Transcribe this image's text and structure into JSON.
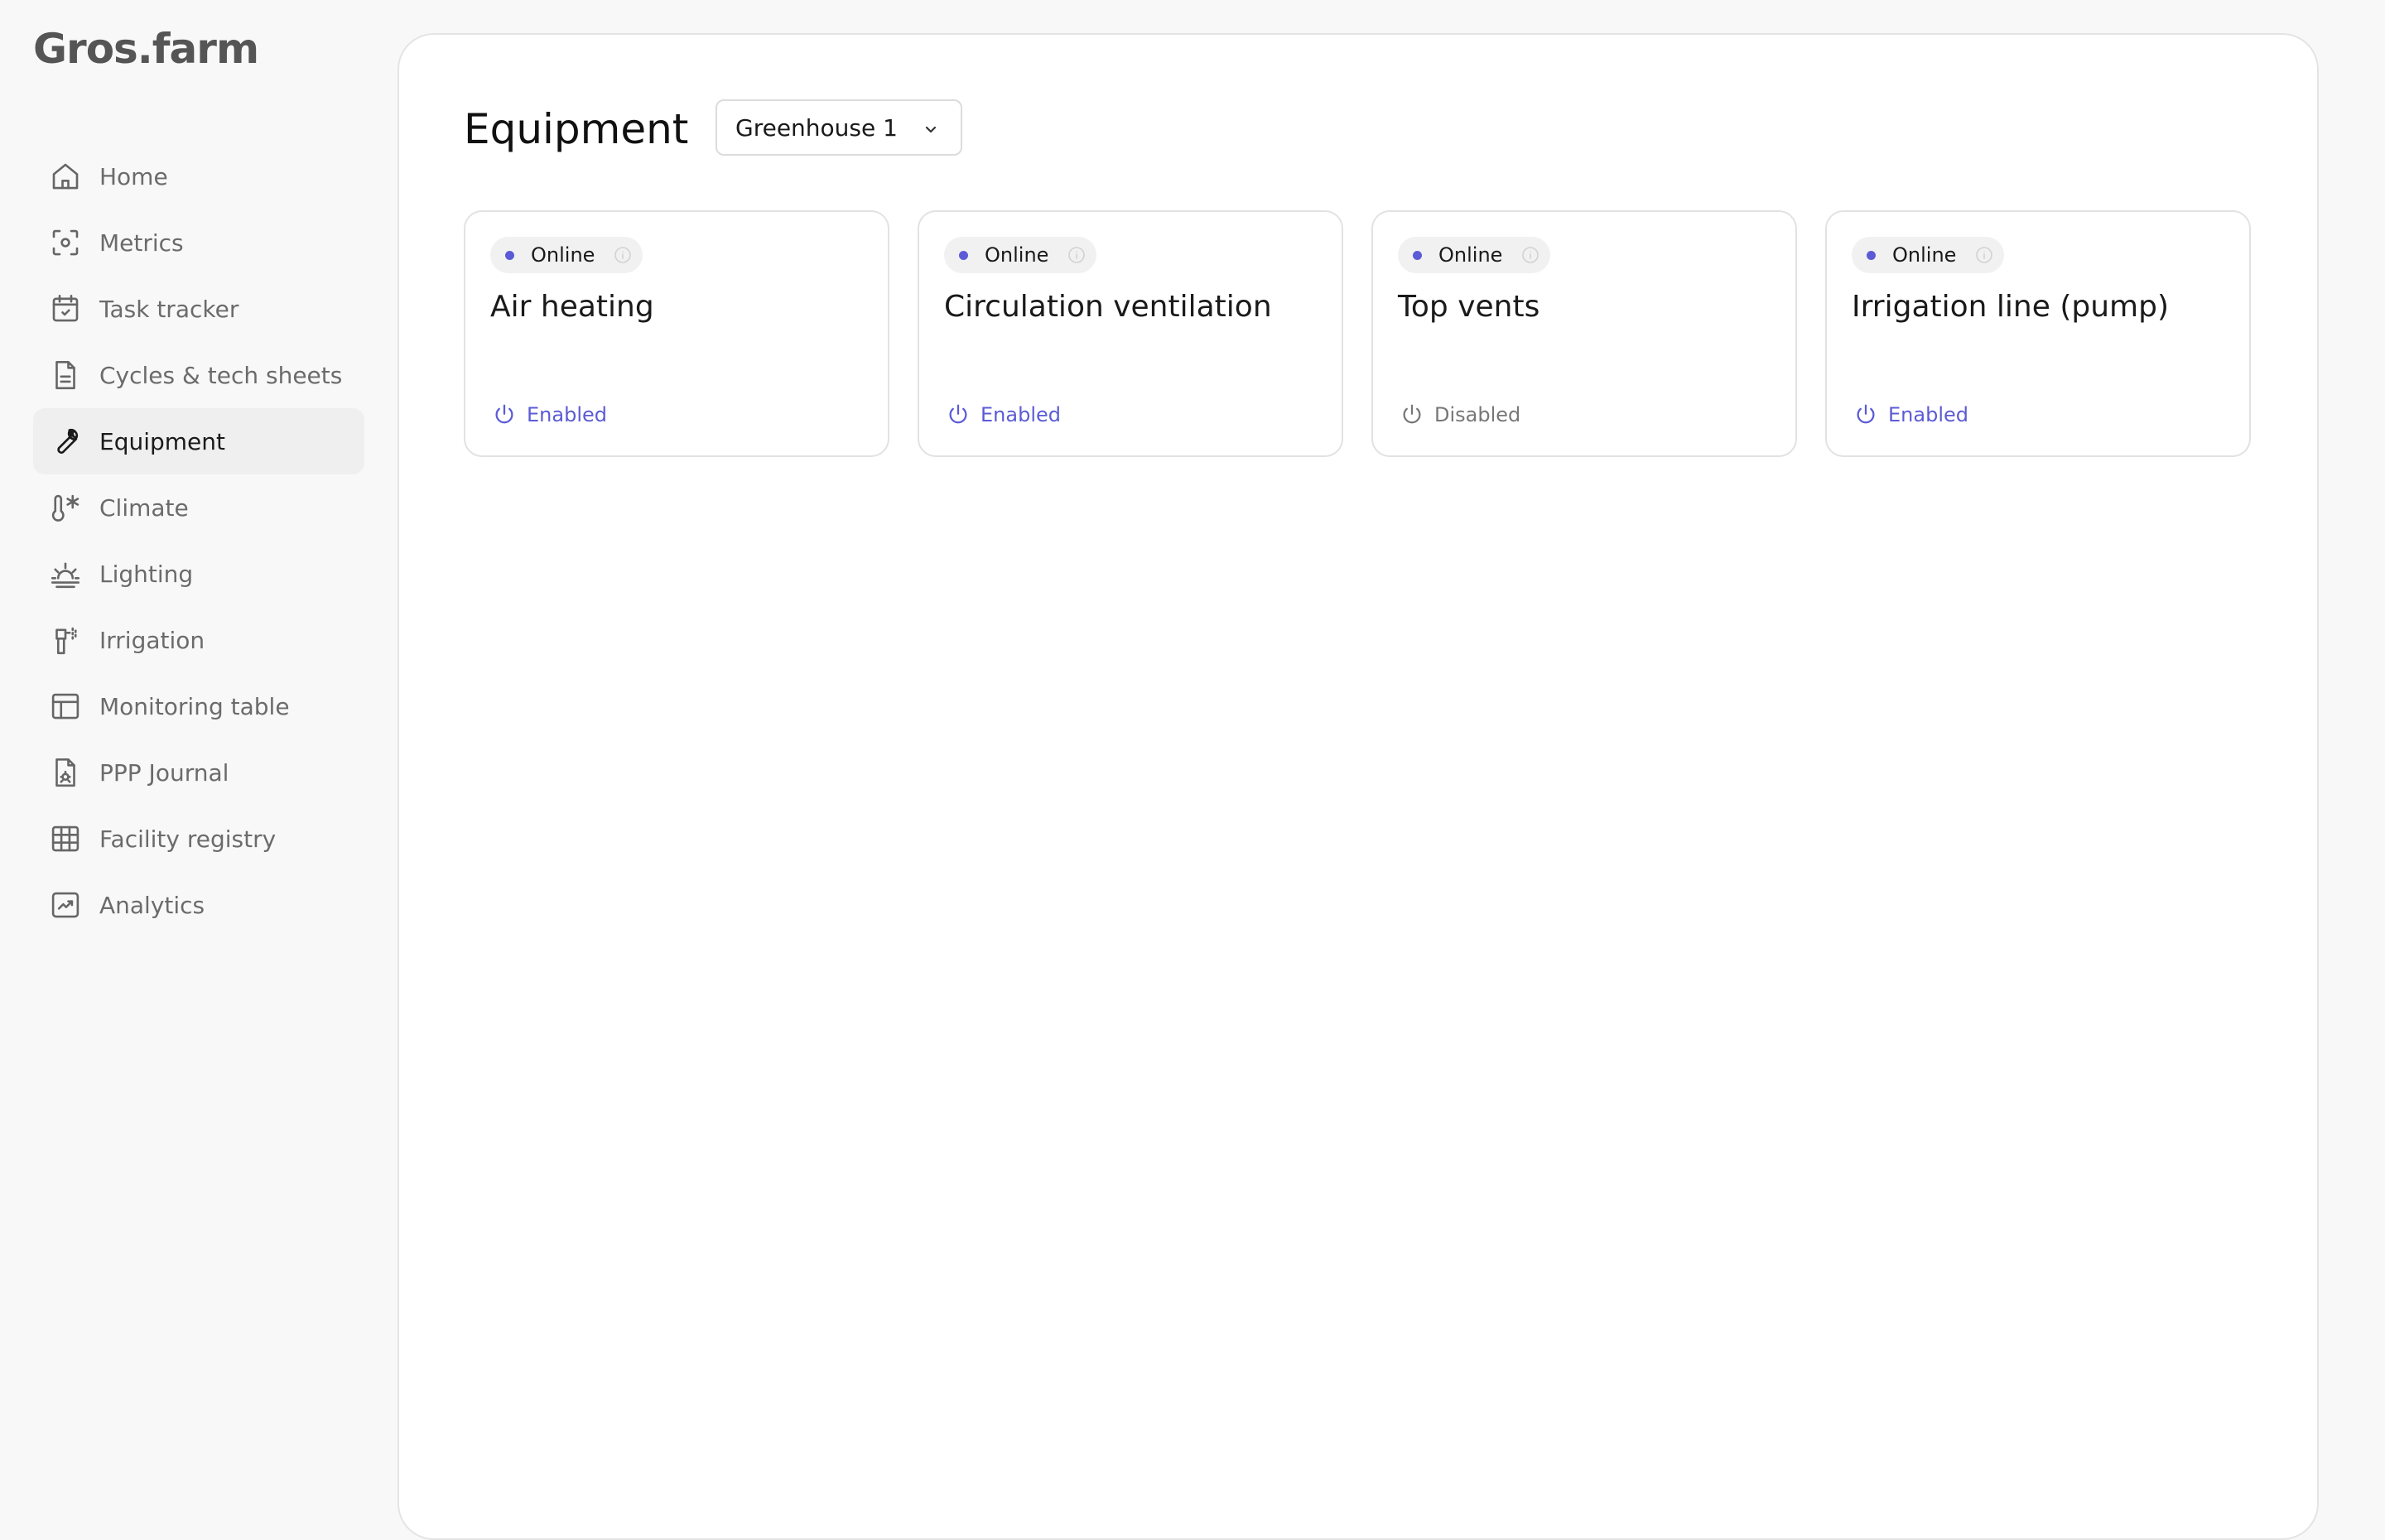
{
  "app": {
    "logo_text": "Gros.farm"
  },
  "sidebar": {
    "items": [
      {
        "label": "Home",
        "icon": "home-icon",
        "active": false
      },
      {
        "label": "Metrics",
        "icon": "metrics-icon",
        "active": false
      },
      {
        "label": "Task tracker",
        "icon": "calendar-check-icon",
        "active": false
      },
      {
        "label": "Cycles & tech sheets",
        "icon": "document-icon",
        "active": false
      },
      {
        "label": "Equipment",
        "icon": "wrench-icon",
        "active": true
      },
      {
        "label": "Climate",
        "icon": "thermometer-snowflake-icon",
        "active": false
      },
      {
        "label": "Lighting",
        "icon": "sunrise-icon",
        "active": false
      },
      {
        "label": "Irrigation",
        "icon": "sprayer-icon",
        "active": false
      },
      {
        "label": "Monitoring table",
        "icon": "table-icon",
        "active": false
      },
      {
        "label": "PPP Journal",
        "icon": "document-bug-icon",
        "active": false
      },
      {
        "label": "Facility registry",
        "icon": "grid-icon",
        "active": false
      },
      {
        "label": "Analytics",
        "icon": "chart-up-icon",
        "active": false
      }
    ]
  },
  "main": {
    "title": "Equipment",
    "greenhouse_select": {
      "selected": "Greenhouse 1"
    },
    "cards": [
      {
        "status": "Online",
        "title": "Air heating",
        "power_state": "Enabled"
      },
      {
        "status": "Online",
        "title": "Circulation ventilation",
        "power_state": "Enabled"
      },
      {
        "status": "Online",
        "title": "Top vents",
        "power_state": "Disabled"
      },
      {
        "status": "Online",
        "title": "Irrigation line (pump)",
        "power_state": "Enabled"
      }
    ]
  },
  "colors": {
    "accent": "#5b5bd6",
    "disabled": "#777777",
    "sidebar_bg": "#f8f8f8",
    "active_item_bg": "#efefef"
  }
}
